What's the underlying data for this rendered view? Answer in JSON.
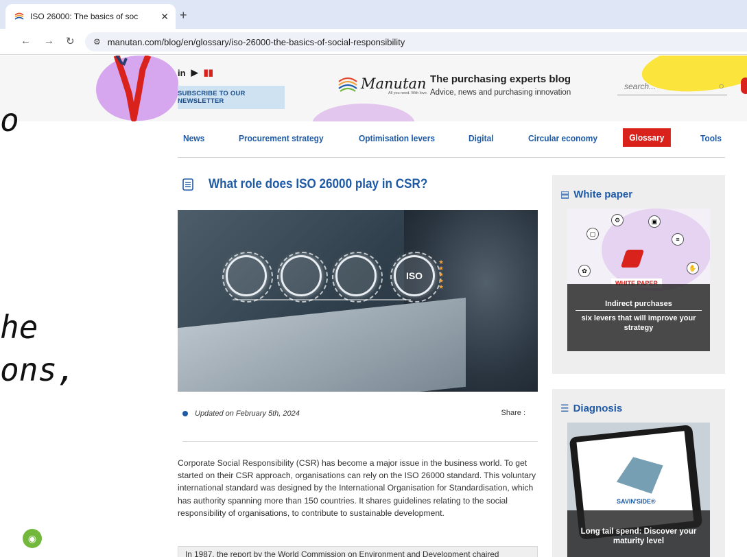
{
  "browser": {
    "tab_title": "ISO 26000: The basics of soc",
    "tab_close": "✕",
    "new_tab": "+",
    "url_domain": "manutan.com",
    "url_path": "/blog/en/glossary/iso-26000-the-basics-of-social-responsibility"
  },
  "header": {
    "social": {
      "linkedin": "in",
      "youtube": "▶",
      "flag": "▮▮"
    },
    "newsletter_label": "SUBSCRIBE TO OUR NEWSLETTER",
    "brand_name": "Manutan",
    "brand_tagline": "All you need. With love.",
    "blog_title": "The purchasing experts blog",
    "blog_subtitle": "Advice, news and purchasing innovation",
    "search_placeholder": "search..."
  },
  "overflow_text": {
    "o": "o",
    "he": "he",
    "ons": "ons,"
  },
  "nav": {
    "items": [
      {
        "label": "News"
      },
      {
        "label": "Procurement strategy"
      },
      {
        "label": "Optimisation levers"
      },
      {
        "label": "Digital"
      },
      {
        "label": "Circular economy"
      },
      {
        "label": "Glossary"
      },
      {
        "label": "Tools"
      }
    ],
    "active_color": "#d9221c"
  },
  "article": {
    "title": "What role does ISO 26000 play in CSR?",
    "hero_gear_labels": [
      "",
      "",
      "",
      "ISO"
    ],
    "updated": "Updated on February 5th, 2024",
    "share_label": "Share :",
    "intro": "Corporate Social Responsibility (CSR) has become a major issue in the business world. To get started on their CSR approach, organisations can rely on the ISO 26000 standard. This voluntary international standard was designed by the International Organisation for Standardisation, which has authority spanning more than 150 countries. It shares guidelines relating to the social responsibility of organisations, to contribute to sustainable development.",
    "quote_start": "In 1987, the report by the World Commission on Environment and Development chaired"
  },
  "sidebar": {
    "white_paper": {
      "heading": "White paper",
      "tag": "WHITE PAPER",
      "line1": "Indirect purchases",
      "line2": "six levers that will improve your strategy"
    },
    "diagnosis": {
      "heading": "Diagnosis",
      "tag": "SAVIN'SIDE®",
      "text": "Long tail spend: Discover your maturity level"
    }
  },
  "colors": {
    "link_blue": "#1f5aa6",
    "accent_red": "#d9221c",
    "newsletter_bg": "#cfe2f2",
    "cookie_green": "#72b83c"
  }
}
